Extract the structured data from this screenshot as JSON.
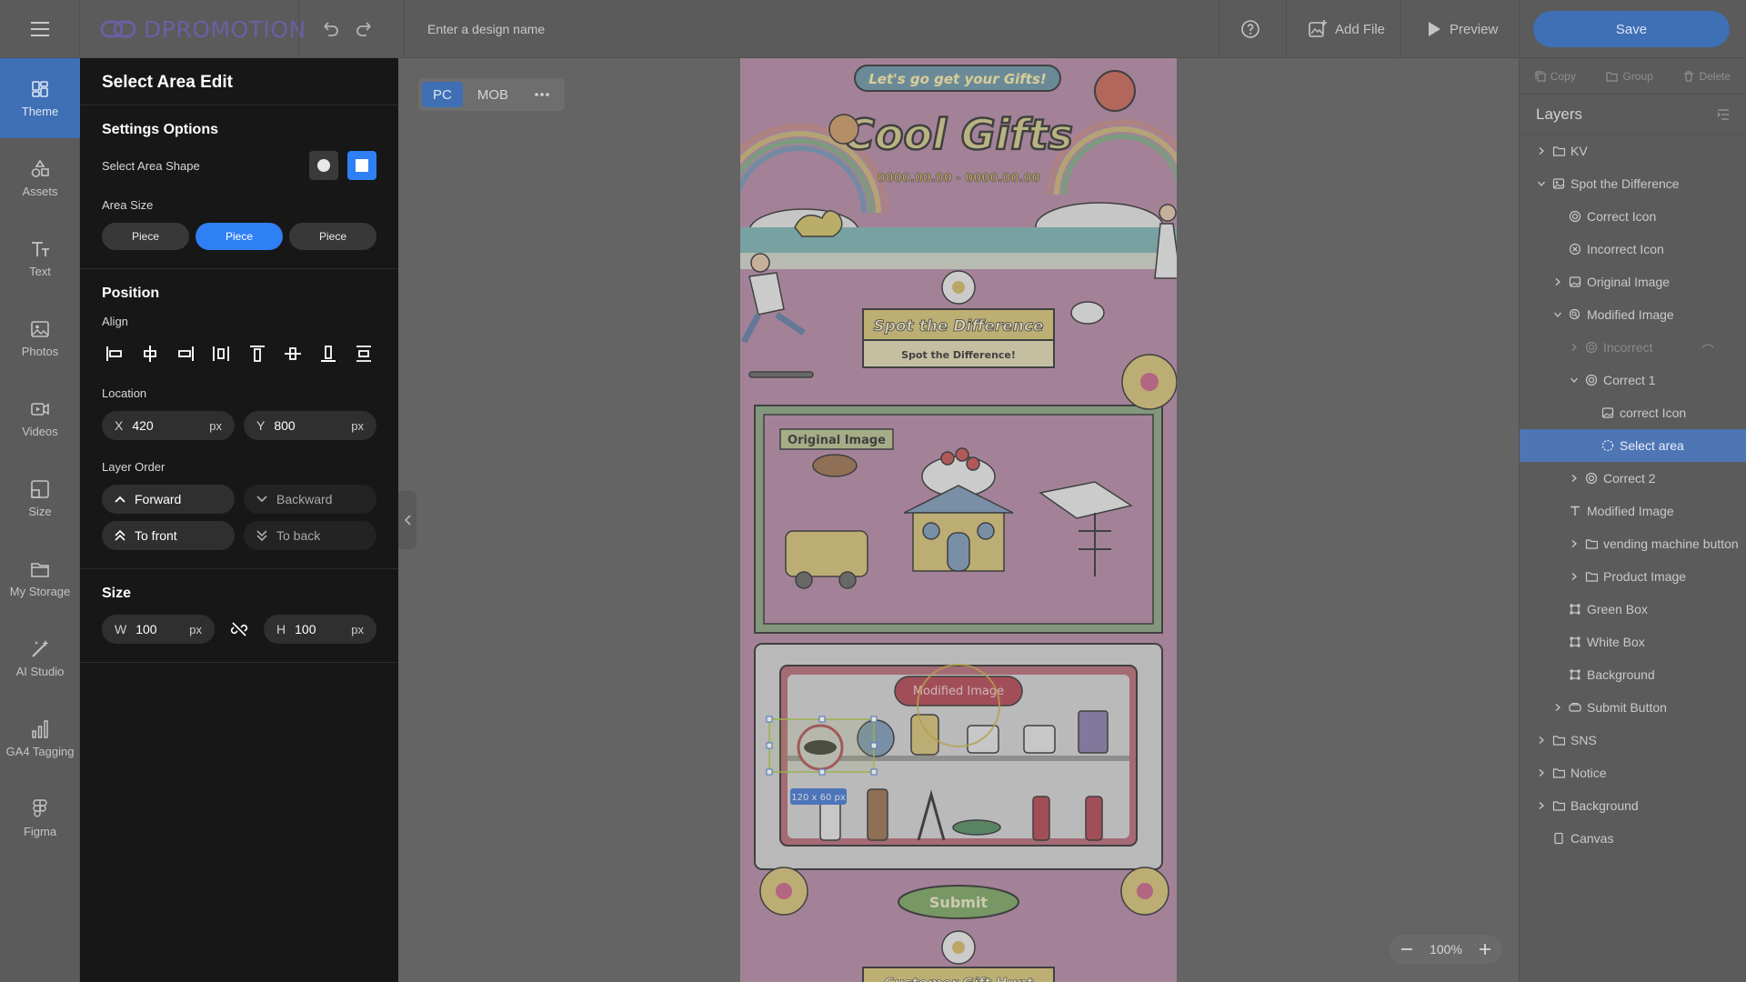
{
  "app": {
    "brand": "DPROMOTION",
    "design_name_placeholder": "Enter a design name",
    "add_file": "Add File",
    "preview": "Preview",
    "save": "Save"
  },
  "nav": [
    {
      "label": "Theme",
      "icon": "theme-icon",
      "active": true
    },
    {
      "label": "Assets",
      "icon": "assets-icon"
    },
    {
      "label": "Text",
      "icon": "text-icon"
    },
    {
      "label": "Photos",
      "icon": "photos-icon"
    },
    {
      "label": "Videos",
      "icon": "videos-icon"
    },
    {
      "label": "Size",
      "icon": "size-icon"
    },
    {
      "label": "My Storage",
      "icon": "folder-icon"
    },
    {
      "label": "AI Studio",
      "icon": "ai-wand-icon"
    },
    {
      "label": "GA4 Tagging",
      "icon": "analytics-icon"
    },
    {
      "label": "Figma",
      "icon": "figma-icon"
    }
  ],
  "panel": {
    "title": "Select Area Edit",
    "settings": {
      "title": "Settings Options",
      "shape_label": "Select Area Shape",
      "area_size_label": "Area Size",
      "size_options": [
        "Piece",
        "Piece",
        "Piece"
      ]
    },
    "position": {
      "title": "Position",
      "align_label": "Align",
      "location_label": "Location",
      "x_key": "X",
      "x_value": "420",
      "y_key": "Y",
      "y_value": "800",
      "unit": "px",
      "layer_order_label": "Layer Order",
      "forward": "Forward",
      "backward": "Backward",
      "to_front": "To front",
      "to_back": "To back"
    },
    "size": {
      "title": "Size",
      "w_key": "W",
      "w_value": "100",
      "h_key": "H",
      "h_value": "100",
      "unit": "px"
    }
  },
  "canvas": {
    "devices": [
      "PC",
      "MOB"
    ],
    "active_device": "PC",
    "zoom": "100%",
    "art": {
      "banner": "Let's go get your Gifts!",
      "headline": "Cool Gifts",
      "date_range": "0000.00.00 - 0000.00.00",
      "spot_title": "Spot the Difference",
      "spot_subtitle": "Spot the Difference!",
      "original_label": "Original Image",
      "modified_label": "Modified Image",
      "selection_size": "120 x 60 px",
      "submit": "Submit",
      "bottom_banner": "Customer Gift Hunt"
    }
  },
  "right": {
    "actions": [
      "Copy",
      "Group",
      "Delete"
    ],
    "layers_title": "Layers",
    "layers": [
      {
        "label": "KV",
        "icon": "folder",
        "indent": 0,
        "chevron": "right"
      },
      {
        "label": "Spot the Difference",
        "icon": "component",
        "indent": 0,
        "chevron": "down"
      },
      {
        "label": "Correct Icon",
        "icon": "target",
        "indent": 1,
        "chevron": "none"
      },
      {
        "label": "Incorrect Icon",
        "icon": "x-circle",
        "indent": 1,
        "chevron": "none"
      },
      {
        "label": "Original Image",
        "icon": "image",
        "indent": 1,
        "chevron": "right"
      },
      {
        "label": "Modified Image",
        "icon": "search-circle",
        "indent": 1,
        "chevron": "down"
      },
      {
        "label": "Incorrect",
        "icon": "target",
        "indent": 2,
        "chevron": "right",
        "faded": true
      },
      {
        "label": "Correct 1",
        "icon": "target",
        "indent": 2,
        "chevron": "down"
      },
      {
        "label": "correct Icon",
        "icon": "image",
        "indent": 3,
        "chevron": "none"
      },
      {
        "label": "Select area",
        "icon": "dashed-circle",
        "indent": 3,
        "chevron": "none",
        "selected": true
      },
      {
        "label": "Correct 2",
        "icon": "target",
        "indent": 2,
        "chevron": "right"
      },
      {
        "label": "Modified Image",
        "icon": "text",
        "indent": 1,
        "chevron": "none"
      },
      {
        "label": "vending machine button",
        "icon": "folder",
        "indent": 2,
        "chevron": "right"
      },
      {
        "label": "Product Image",
        "icon": "folder",
        "indent": 2,
        "chevron": "right"
      },
      {
        "label": "Green Box",
        "icon": "shape",
        "indent": 1,
        "chevron": "none"
      },
      {
        "label": "White Box",
        "icon": "shape",
        "indent": 1,
        "chevron": "none"
      },
      {
        "label": "Background",
        "icon": "shape",
        "indent": 1,
        "chevron": "none"
      },
      {
        "label": "Submit Button",
        "icon": "button",
        "indent": 1,
        "chevron": "right"
      },
      {
        "label": "SNS",
        "icon": "folder",
        "indent": 0,
        "chevron": "right"
      },
      {
        "label": "Notice",
        "icon": "folder",
        "indent": 0,
        "chevron": "right"
      },
      {
        "label": "Background",
        "icon": "folder",
        "indent": 0,
        "chevron": "right"
      },
      {
        "label": "Canvas",
        "icon": "page",
        "indent": 0,
        "chevron": "none"
      }
    ]
  }
}
